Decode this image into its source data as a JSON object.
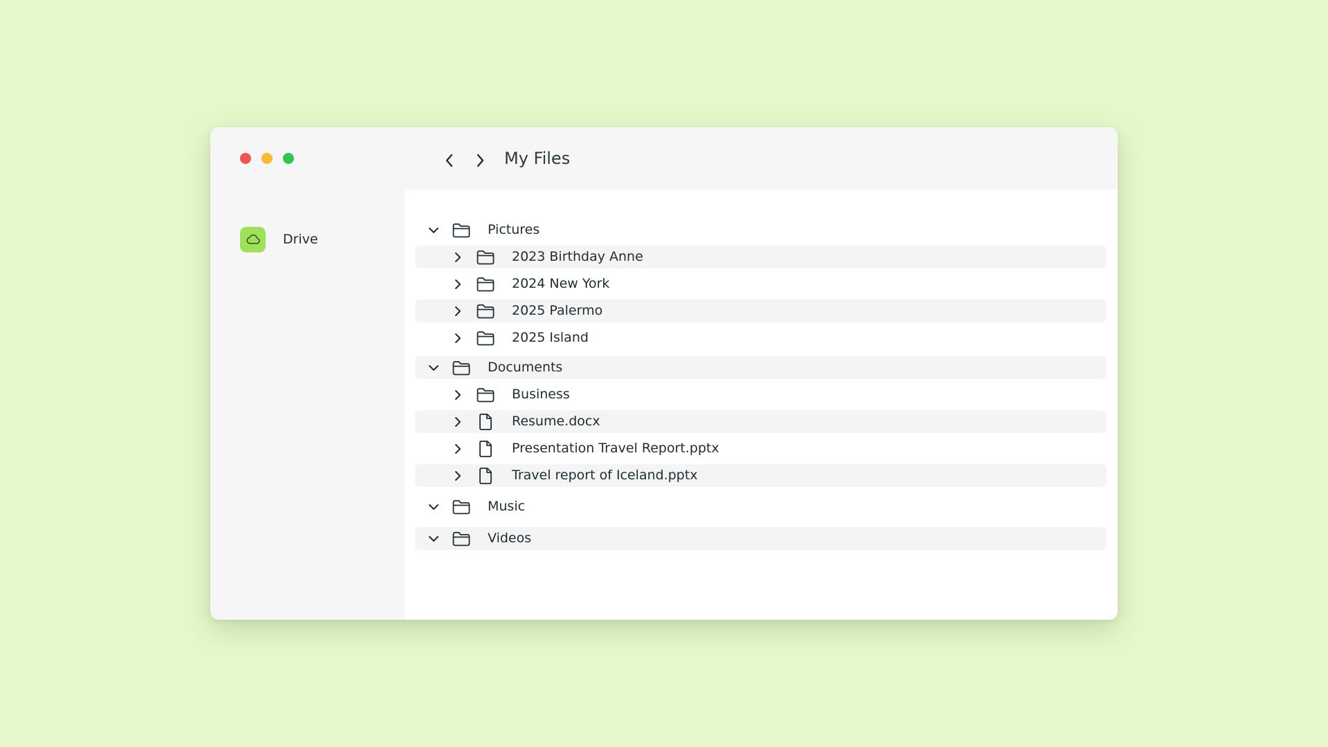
{
  "window": {
    "title": "My Files",
    "traffic_lights": [
      "close",
      "minimize",
      "maximize"
    ]
  },
  "colors": {
    "background": "#e5f8cc",
    "window": "#f6f6f6",
    "content": "#ffffff",
    "row_highlight": "#f4f4f4",
    "drive_accent": "#9fe25a",
    "close": "#f25454",
    "minimize": "#f9bc31",
    "maximize": "#2fc84e"
  },
  "sidebar": {
    "items": [
      {
        "label": "Drive",
        "icon": "cloud-icon"
      }
    ]
  },
  "header": {
    "back_icon": "chevron-left-icon",
    "forward_icon": "chevron-right-icon",
    "title": "My Files"
  },
  "tree": {
    "items": [
      {
        "label": "Pictures",
        "type": "folder",
        "expanded": true
      },
      {
        "label": "2023 Birthday Anne",
        "type": "folder",
        "expanded": false
      },
      {
        "label": "2024 New York",
        "type": "folder",
        "expanded": false
      },
      {
        "label": "2025 Palermo",
        "type": "folder",
        "expanded": false
      },
      {
        "label": "2025 Island",
        "type": "folder",
        "expanded": false
      },
      {
        "label": "Documents",
        "type": "folder",
        "expanded": true
      },
      {
        "label": "Business",
        "type": "folder",
        "expanded": false
      },
      {
        "label": "Resume.docx",
        "type": "file",
        "expanded": false
      },
      {
        "label": "Presentation Travel Report.pptx",
        "type": "file",
        "expanded": false
      },
      {
        "label": "Travel report of Iceland.pptx",
        "type": "file",
        "expanded": false
      },
      {
        "label": "Music",
        "type": "folder",
        "expanded": true
      },
      {
        "label": "Videos",
        "type": "folder",
        "expanded": true
      }
    ]
  }
}
